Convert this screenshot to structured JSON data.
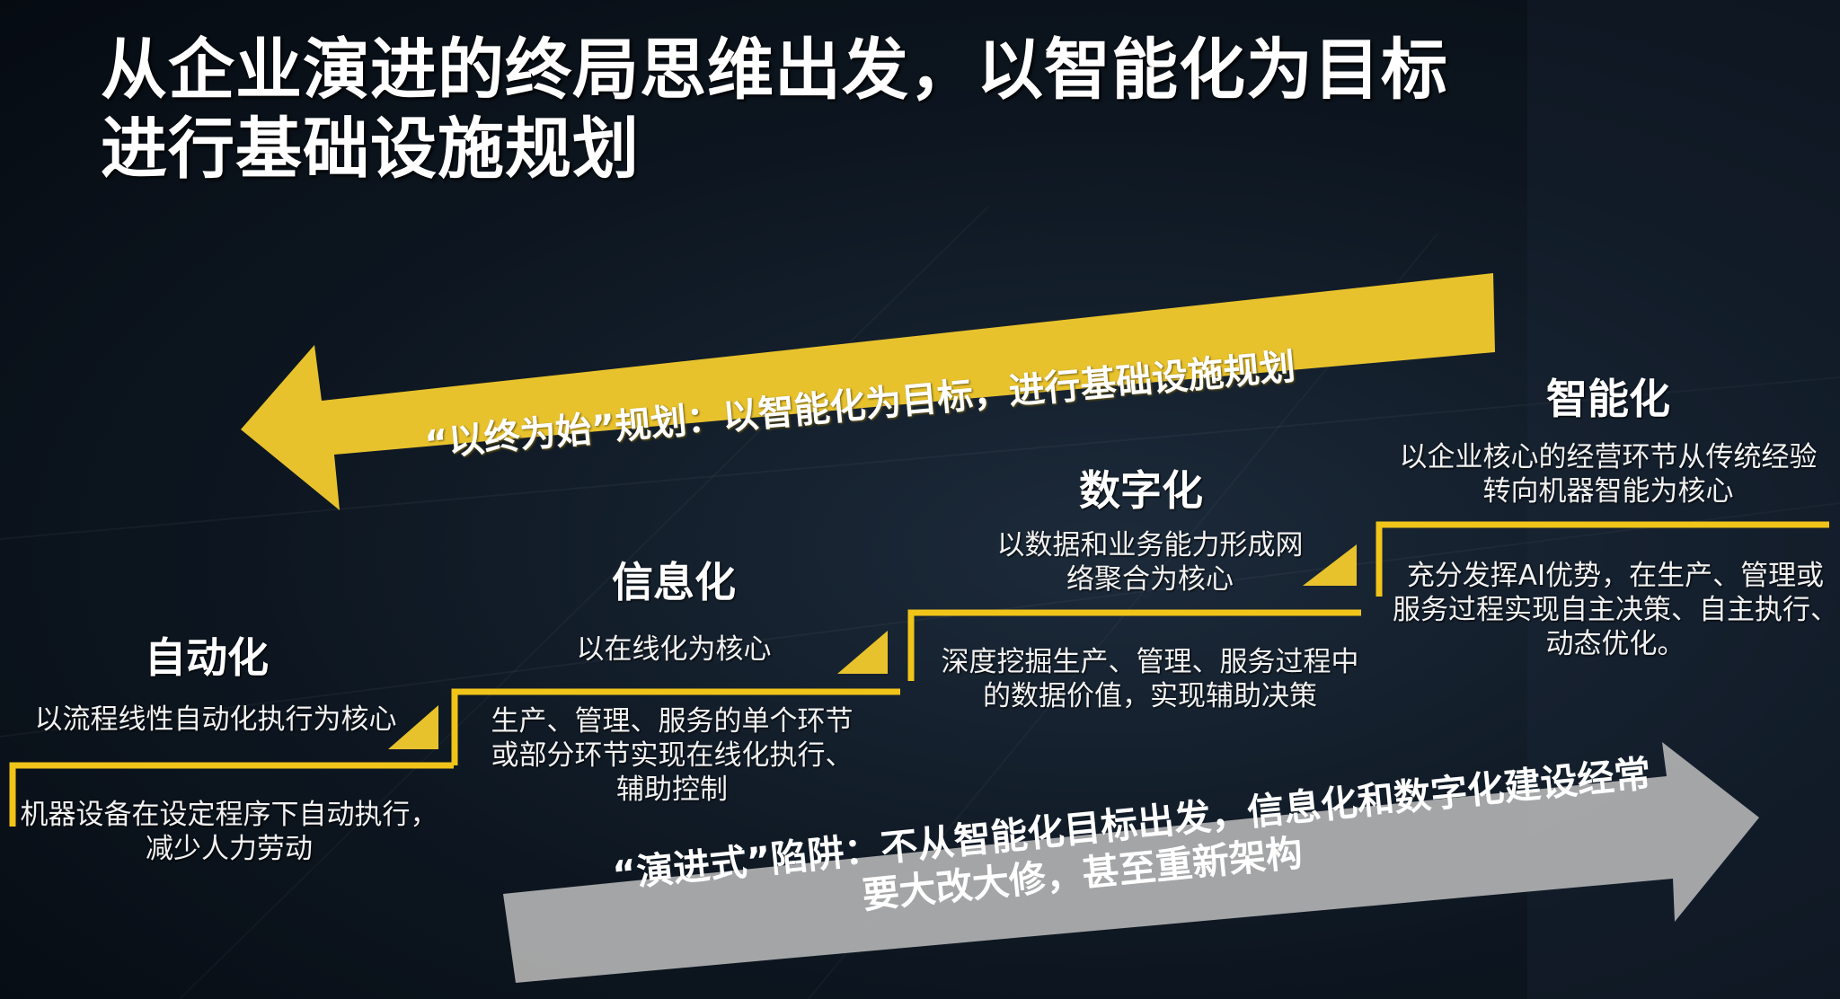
{
  "title": {
    "line1": "从企业演进的终局思维出发，以智能化为目标",
    "line2": "进行基础设施规划"
  },
  "top_arrow": {
    "text": "“以终为始”规划：以智能化为目标，进行基础设施规划",
    "color": "#e8c22d"
  },
  "bottom_arrow": {
    "line1": "“演进式”陷阱：不从智能化目标出发，信息化和数字化建设经常",
    "line2": "要大改大修，甚至重新架构",
    "color": "#b5b5b5"
  },
  "stages": [
    {
      "name": "自动化",
      "core": "以流程线性自动化执行为核心",
      "detail_line1": "机器设备在设定程序下自动执行，",
      "detail_line2": "减少人力劳动",
      "detail_line3": ""
    },
    {
      "name": "信息化",
      "core": "以在线化为核心",
      "detail_line1": "生产、管理、服务的单个环节",
      "detail_line2": "或部分环节实现在线化执行、",
      "detail_line3": "辅助控制"
    },
    {
      "name": "数字化",
      "core_line1": "以数据和业务能力形成网",
      "core_line2": "络聚合为核心",
      "detail_line1": "深度挖掘生产、管理、服务过程中",
      "detail_line2": "的数据价值，实现辅助决策",
      "detail_line3": ""
    },
    {
      "name": "智能化",
      "core_line1": "以企业核心的经营环节从传统经验",
      "core_line2": "转向机器智能为核心",
      "detail_line1": "充分发挥AI优势，在生产、管理或",
      "detail_line2": "服务过程实现自主决策、自主执行、",
      "detail_line3": "动态优化。"
    }
  ],
  "colors": {
    "accent_yellow": "#e8c22d",
    "step_yellow": "#f0c419",
    "arrow_gray": "#b5b5b5"
  }
}
